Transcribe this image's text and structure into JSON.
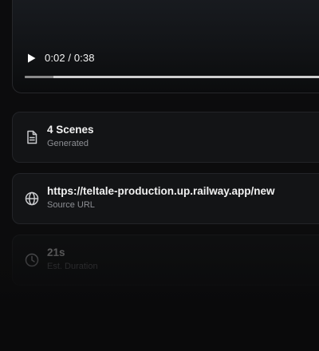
{
  "player": {
    "current_time": "0:02",
    "separator": " / ",
    "duration": "0:38",
    "progress_fraction": 0.09
  },
  "cards": [
    {
      "icon": "document-icon",
      "title": "4 Scenes",
      "subtitle": "Generated"
    },
    {
      "icon": "globe-icon",
      "title": "https://teltale-production.up.railway.app/new",
      "subtitle": "Source URL"
    },
    {
      "icon": "clock-icon",
      "title": "21s",
      "subtitle": "Est. Duration"
    }
  ]
}
